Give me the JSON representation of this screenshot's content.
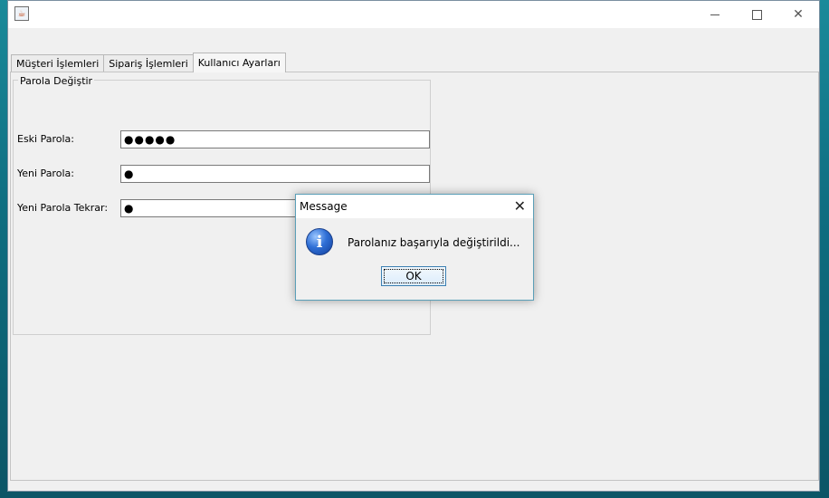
{
  "window": {
    "icon": "java-icon",
    "controls": {
      "minimize": "minimize-icon",
      "maximize": "maximize-icon",
      "close": "close-icon"
    }
  },
  "tabs": [
    {
      "label": "Müşteri İşlemleri"
    },
    {
      "label": "Sipariş İşlemleri"
    },
    {
      "label": "Kullanıcı Ayarları",
      "active": true
    }
  ],
  "password_group": {
    "title": "Parola Değiştir",
    "fields": [
      {
        "label": "Eski Parola:",
        "value": "●●●●●"
      },
      {
        "label": "Yeni Parola:",
        "value": "●"
      },
      {
        "label": "Yeni Parola Tekrar:",
        "value": "●"
      }
    ]
  },
  "dialog": {
    "title": "Message",
    "message": "Parolanız başarıyla değiştirildi...",
    "ok_label": "OK",
    "icon": "info-icon"
  },
  "colors": {
    "accent_border": "#3c7fb1",
    "dialog_border": "#5b9fb8",
    "panel_bg": "#f0f0f0"
  }
}
